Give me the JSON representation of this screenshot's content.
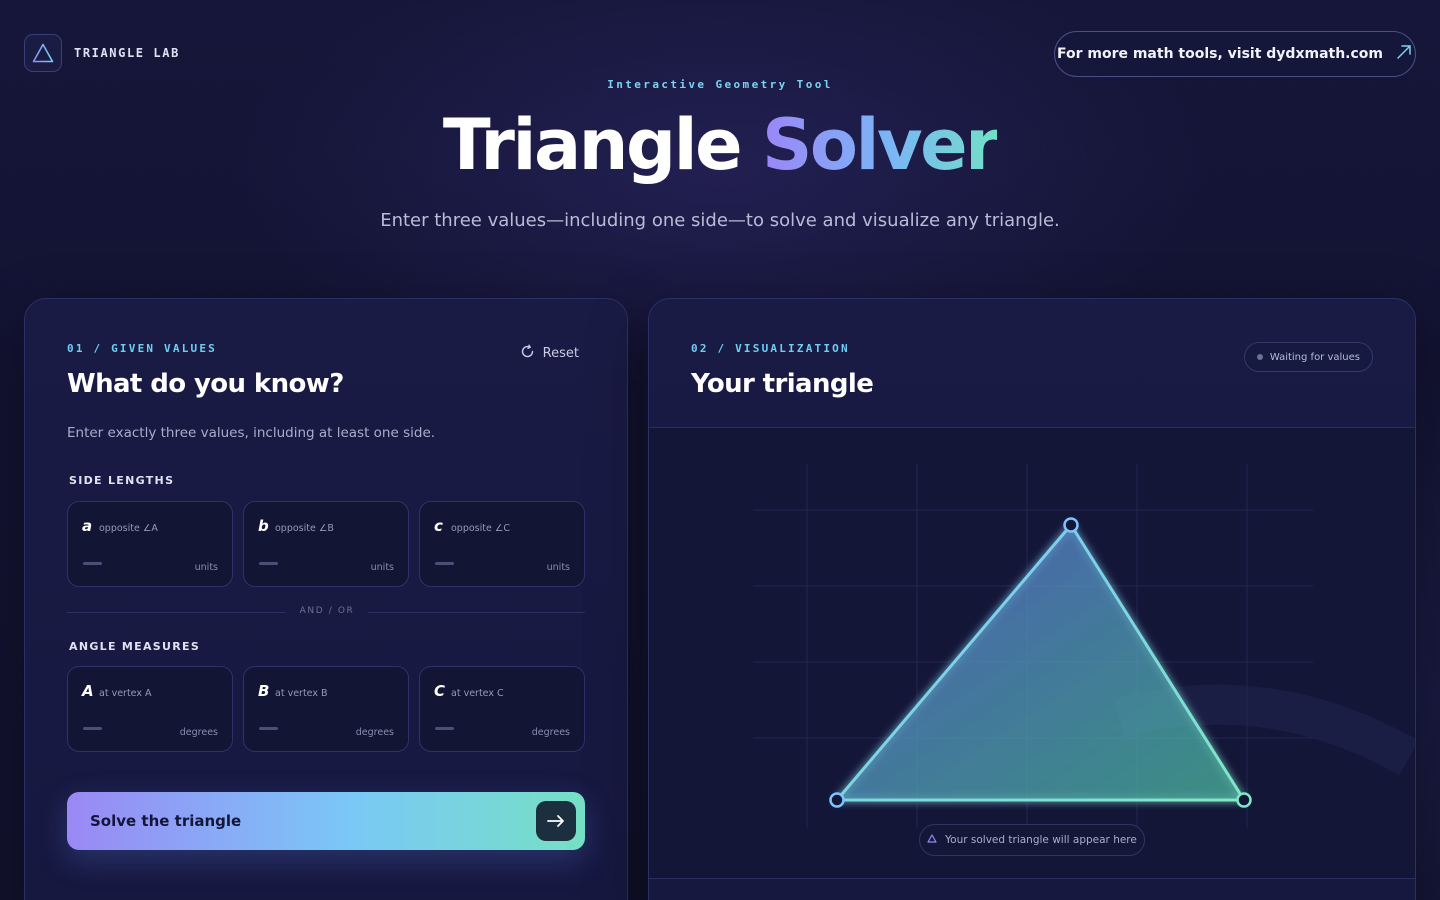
{
  "brand": {
    "name": "TRIANGLE LAB",
    "logo_icon": "triangle-icon"
  },
  "header_link": {
    "label": "For more math tools, visit dydxmath.com",
    "icon": "arrow-up-right-icon"
  },
  "hero": {
    "eyebrow": "Interactive Geometry Tool",
    "title_main": "Triangle",
    "title_accent": "Solver",
    "subtitle": "Enter three values—including one side—to solve and visualize any triangle."
  },
  "given": {
    "eyebrow": "01 / GIVEN VALUES",
    "title": "What do you know?",
    "reset_label": "Reset",
    "intro": "Enter exactly three values, including at least one side.",
    "sides_label": "SIDE LENGTHS",
    "sides": [
      {
        "letter": "a",
        "hint": "opposite ∠A",
        "unit": "units"
      },
      {
        "letter": "b",
        "hint": "opposite ∠B",
        "unit": "units"
      },
      {
        "letter": "c",
        "hint": "opposite ∠C",
        "unit": "units"
      }
    ],
    "divider": "AND / OR",
    "angles_label": "ANGLE MEASURES",
    "angles": [
      {
        "letter": "A",
        "hint": "at vertex A",
        "unit": "degrees"
      },
      {
        "letter": "B",
        "hint": "at vertex B",
        "unit": "degrees"
      },
      {
        "letter": "C",
        "hint": "at vertex C",
        "unit": "degrees"
      }
    ],
    "solve_label": "Solve the triangle"
  },
  "visualization": {
    "eyebrow": "02 / VISUALIZATION",
    "title": "Your triangle",
    "status": "Waiting for values",
    "caption": "Your solved triangle will appear here"
  },
  "colors": {
    "accent_purple": "#9a88f5",
    "accent_cyan": "#7ac8f6",
    "accent_teal": "#75e0c5",
    "background": "#131333"
  }
}
